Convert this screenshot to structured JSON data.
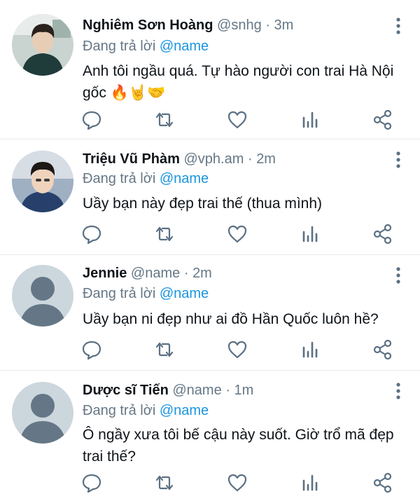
{
  "replies": [
    {
      "name": "Nghiêm Sơn Hoàng",
      "handle": "@snhg",
      "separator": "·",
      "time": "3m",
      "replying_prefix": "Đang trả lời",
      "replying_to": "@name",
      "text_lines": [
        "Anh tôi ngầu quá. Tự hào người con trai Hà Nội",
        "gốc 🔥🤘🤝"
      ],
      "avatar": "photo-young-man-selfie"
    },
    {
      "name": "Triệu Vũ Phàm",
      "handle": "@vph.am",
      "separator": "·",
      "time": "2m",
      "replying_prefix": "Đang trả lời",
      "replying_to": "@name",
      "text_lines": [
        "Uầy bạn này đẹp trai thế (thua mình)"
      ],
      "avatar": "photo-boy-portrait"
    },
    {
      "name": "Jennie",
      "handle": "@name",
      "separator": "·",
      "time": "2m",
      "replying_prefix": "Đang trả lời",
      "replying_to": "@name",
      "text_lines": [
        "Uầy bạn ni đẹp như ai đồ Hần Quốc luôn hề?"
      ],
      "avatar": "default-avatar"
    },
    {
      "name": "Dược sĩ Tiến",
      "handle": "@name",
      "separator": "·",
      "time": "1m",
      "replying_prefix": "Đang trả lời",
      "replying_to": "@name",
      "text_lines": [
        "Ô ngầy xưa tôi bế cậu này suốt. Giờ trổ mã đẹp",
        "trai thế?"
      ],
      "avatar": "default-avatar"
    }
  ],
  "icons": [
    "reply-icon",
    "retweet-icon",
    "like-icon",
    "analytics-icon",
    "share-icon",
    "more-options-icon"
  ],
  "colors": {
    "secondary_text": "#657786",
    "mention": "#1b95e0",
    "icon": "#5b7083",
    "divider": "#e6e9ec"
  }
}
